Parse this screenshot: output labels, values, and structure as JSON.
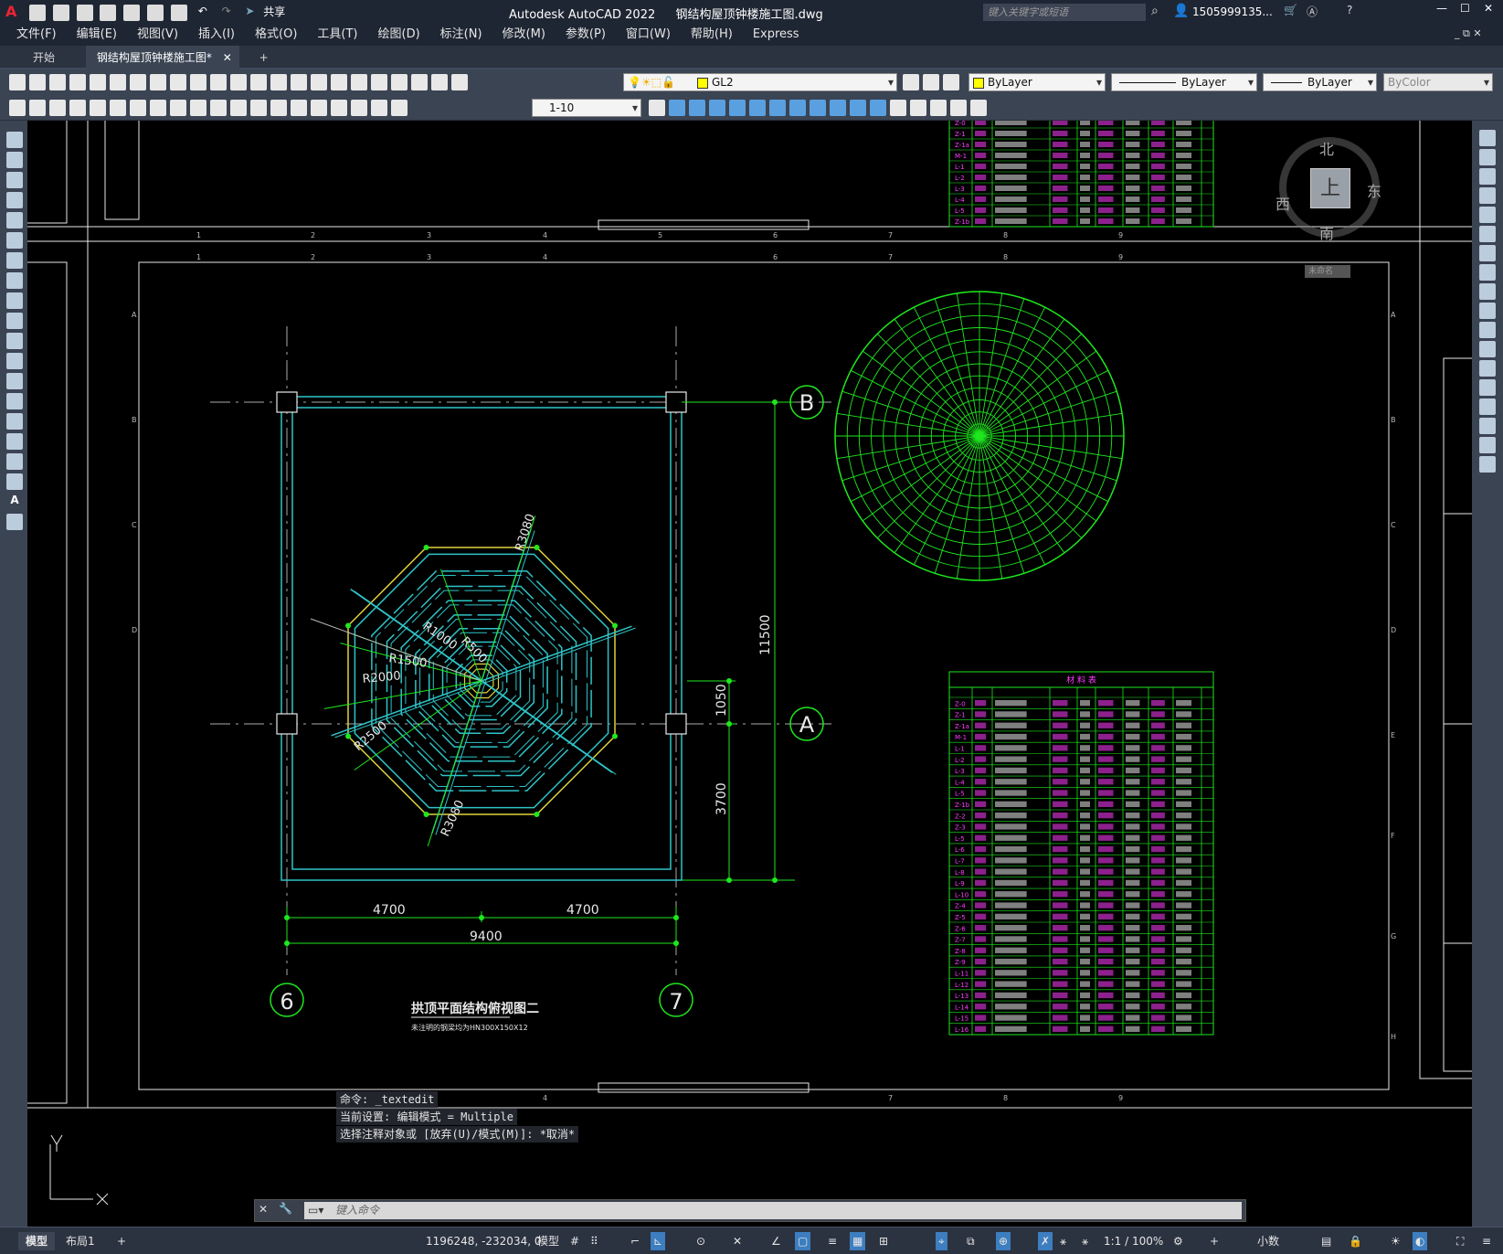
{
  "titlebar": {
    "app_title": "Autodesk AutoCAD 2022",
    "file_title": "钢结构屋顶钟楼施工图.dwg",
    "search_placeholder": "键入关键字或短语",
    "user": "1505999135...",
    "share_label": "共享"
  },
  "menu": [
    "文件(F)",
    "编辑(E)",
    "视图(V)",
    "插入(I)",
    "格式(O)",
    "工具(T)",
    "绘图(D)",
    "标注(N)",
    "修改(M)",
    "参数(P)",
    "窗口(W)",
    "帮助(H)",
    "Express"
  ],
  "tabs": [
    {
      "label": "开始"
    },
    {
      "label": "钢结构屋顶钟楼施工图*"
    }
  ],
  "toolbar": {
    "layer": "GL2",
    "color": "ByLayer",
    "linetype": "ByLayer",
    "lineweight": "ByLayer",
    "plotstyle": "ByColor",
    "scale": "1-10"
  },
  "viewcube": {
    "north": "北",
    "south": "南",
    "east": "东",
    "west": "西",
    "top": "上",
    "wcs": "未命名"
  },
  "drawing": {
    "title": "拱顶平面结构俯视图二",
    "subtitle": "未注明的钢梁均为HN300X150X12",
    "grid_b": "B",
    "grid_a": "A",
    "grid_6": "6",
    "grid_7": "7",
    "dim_4700_l": "4700",
    "dim_4700_r": "4700",
    "dim_9400": "9400",
    "dim_11500": "11500",
    "dim_1050": "1050",
    "dim_3700": "3700",
    "r3080_top": "R3080",
    "r3080_bot": "R3080",
    "r1000": "R1000",
    "r500": "R500",
    "r1500": "R1500",
    "r2000": "R2000",
    "r2500": "R2500",
    "table_title": "材 料 表",
    "table_rows": [
      "Z-0",
      "Z-1",
      "Z-1a",
      "M-1",
      "L-1",
      "L-2",
      "L-3",
      "L-4",
      "L-5",
      "Z-1b",
      "Z-2",
      "Z-3",
      "L-5",
      "L-6",
      "L-7",
      "L-8",
      "L-9",
      "L-10",
      "Z-4",
      "Z-5",
      "Z-6",
      "Z-7",
      "Z-8",
      "Z-9",
      "L-11",
      "L-12",
      "L-13",
      "L-14",
      "L-15",
      "L-16"
    ]
  },
  "command": {
    "line1": "命令:  _textedit",
    "line2": "当前设置: 编辑模式 = Multiple",
    "line3": "选择注释对象或 [放弃(U)/模式(M)]: *取消*",
    "placeholder": "键入命令"
  },
  "status": {
    "tab_model": "模型",
    "tab_layout": "布局1",
    "coords": "1196248, -232034, 0",
    "model": "模型",
    "annoscale": "1:1 / 100%",
    "units": "小数"
  }
}
